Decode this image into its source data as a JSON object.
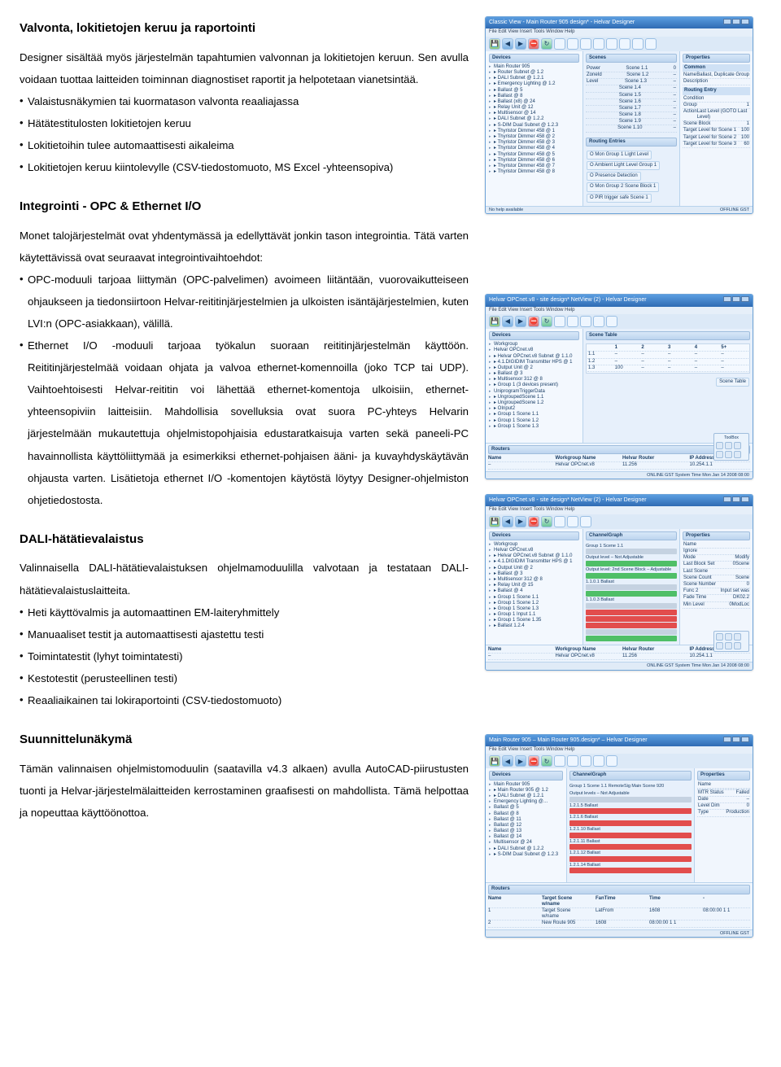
{
  "sections": {
    "valvonta": {
      "heading": "Valvonta, lokitietojen keruu ja raportointi",
      "p1": "Designer sisältää myös järjestelmän tapahtumien valvonnan ja lokitietojen keruun. Sen avulla voidaan tuottaa laitteiden toiminnan diagnostiset raportit ja helpotetaan vianetsintää.",
      "bullets": [
        "Valaistusnäkymien tai kuormatason valvonta reaaliajassa",
        "Hätätestitulosten lokitietojen keruu",
        "Lokitietoihin tulee automaattisesti aikaleima",
        "Lokitietojen keruu kiintolevylle (CSV-tiedostomuoto, MS Excel -yhteensopiva)"
      ]
    },
    "integrointi": {
      "heading": "Integrointi - OPC & Ethernet I/O",
      "p1": "Monet talojärjestelmät ovat yhdentymässä ja edellyttävät jonkin tason integrointia. Tätä varten käytettävissä ovat seuraavat integrointivaihtoehdot:",
      "bullets": [
        "OPC-moduuli tarjoaa liittymän (OPC-palvelimen) avoimeen liitäntään, vuorovaikutteiseen ohjaukseen ja tiedonsiirtoon Helvar-reititinjärjestelmien ja ulkoisten isäntäjärjestelmien, kuten LVI:n (OPC-asiakkaan), välillä.",
        "Ethernet I/O -moduuli tarjoaa työkalun suoraan reititinjärjestelmän käyttöön. Reititinjärjestelmää voidaan ohjata ja valvoa ethernet-komennoilla (joko TCP tai UDP). Vaihtoehtoisesti Helvar-reititin voi lähettää ethernet-komentoja ulkoisiin, ethernet-yhteensopiviin laitteisiin. Mahdollisia sovelluksia ovat suora PC-yhteys Helvarin järjestelmään mukautettuja ohjelmistopohjaisia edustaratkaisuja varten sekä paneeli-PC havainnollista käyttöliittymää ja esimerkiksi ethernet-pohjaisen ääni- ja kuvayhdyskäytävän ohjausta varten. Lisätietoja ethernet I/O -komentojen käytöstä löytyy Designer-ohjelmiston ohjetiedostosta."
      ]
    },
    "dali": {
      "heading": "DALI-hätätievalaistus",
      "p1": "Valinnaisella DALI-hätätievalaistuksen ohjelmamoduulilla valvotaan ja testataan DALI-hätätievalaistuslaitteita.",
      "bullets": [
        "Heti käyttövalmis ja automaattinen EM-laiteryhmittely",
        "Manuaaliset testit ja automaattisesti ajastettu testi",
        "Toimintatestit (lyhyt toimintatesti)",
        "Kestotestit (perusteellinen testi)",
        "Reaaliaikainen tai lokiraportointi (CSV-tiedostomuoto)"
      ]
    },
    "suunnittelu": {
      "heading": "Suunnittelunäkymä",
      "p1": "Tämän valinnaisen ohjelmistomoduulin (saatavilla v4.3 alkaen) avulla AutoCAD-piirustusten tuonti ja Helvar-järjestelmälaitteiden kerrostaminen graafisesti on mahdollista. Tämä helpottaa ja nopeuttaa käyttöönottoa."
    }
  },
  "screenshots": {
    "one": {
      "title": "Classic View - Main Router 905 design* - Helvar Designer",
      "menu": "File  Edit  View  Insert  Tools  Window  Help",
      "panel_devices": "Devices",
      "panel_props": "Properties",
      "panel_routing": "Routing Entries",
      "tree": [
        "Main Router 905",
        "▸ Router Subnet @ 1.2",
        "  ▸ DALI Subnet @ 1.2.1",
        "    ▸ Emergency Lighting @ 1.2",
        "    ▸ Ballast @ 5",
        "    ▸ Ballast @ 8",
        "    ▸ Ballast (x8) @ 24",
        "    ▸ Relay Unit @ 12",
        "    ▸ Multisensor @ 14",
        "  ▸ DALI Subnet @ 1.2.2",
        "  ▸ S-DIM Dual Subnet @ 1.2.3",
        "    ▸ Thyristor Dimmer 458 @ 1",
        "    ▸ Thyristor Dimmer 458 @ 2",
        "    ▸ Thyristor Dimmer 458 @ 3",
        "    ▸ Thyristor Dimmer 458 @ 4",
        "    ▸ Thyristor Dimmer 458 @ 5",
        "    ▸ Thyristor Dimmer 458 @ 6",
        "    ▸ Thyristor Dimmer 458 @ 7",
        "    ▸ Thyristor Dimmer 458 @ 8"
      ],
      "scenes_panel": "Scenes",
      "scenes_rows": [
        [
          "Power",
          "Scene 1.1",
          "0"
        ],
        [
          "ZoneId",
          "Scene 1.2",
          "–"
        ],
        [
          "Level",
          "Scene 1.3",
          "–"
        ],
        [
          "",
          "Scene 1.4",
          "–"
        ],
        [
          "",
          "Scene 1.5",
          "–"
        ],
        [
          "",
          "Scene 1.6",
          "–"
        ],
        [
          "",
          "Scene 1.7",
          "–"
        ],
        [
          "",
          "Scene 1.8",
          "–"
        ],
        [
          "",
          "Scene 1.9",
          "–"
        ],
        [
          "",
          "Scene 1.10",
          "–"
        ]
      ],
      "props_common_hdr": "Common",
      "props_common": [
        [
          "Name",
          "Ballast, Duplicate Group"
        ],
        [
          "Description",
          ""
        ]
      ],
      "routing_hdr": "Routing Entry",
      "routing_rows": [
        [
          "Condition",
          ""
        ],
        [
          "Group",
          "1"
        ],
        [
          "Action",
          "Last Level (GOTO Last Level)"
        ],
        [
          "Scene Block",
          "1"
        ],
        [
          "Target Level for Scene 1",
          "100"
        ],
        [
          "Target Level for Scene 2",
          "100"
        ],
        [
          "Target Level for Scene 3",
          "60"
        ]
      ],
      "pills": [
        [
          "O Mon Group 1 Light Level",
          "O Ambient Light Level Group 1"
        ],
        [
          "O Presence Detection",
          "O Mon Group 2 Scene Block 1"
        ],
        [
          "O PIR trigger safe Scene 1",
          ""
        ]
      ],
      "status_left": "No help available",
      "status_right": "OFFLINE   GST"
    },
    "two": {
      "title": "Helvar OPCnet.v8 - site design* NetView (2) - Helvar Designer",
      "menu": "File  Edit  View  Insert  Tools  Window  Help",
      "panel_devices": "Devices",
      "panel_table": "Scene Table",
      "tree": [
        "Workgroup",
        "Helvar OPCnet.v8",
        "▸ Helvar OPCnet.v8 Subnet @ 1.1.0",
        "  ▸ 4.1.DIGIDIM Transmitter HPS @ 1",
        "  ▸ Output Unit @ 2",
        "  ▸ Ballast @ 3",
        "  ▸ Multisensor 312 @ 8",
        "   ▸ Group 1 (3 devices present)",
        "    UniprogramTriggerData",
        "    ▸ UngroupedScene 1.1",
        "    ▸ UngroupedScene 1.2",
        "    ▸ OInput2",
        "    ▸ Group 1 Scene 1.1",
        "    ▸ Group 1 Scene 1.2",
        "    ▸ Group 1 Scene 1.3"
      ],
      "scene_cols": [
        "",
        "1",
        "2",
        "3",
        "4",
        "5+"
      ],
      "scene_rows": [
        [
          "1.1",
          "–",
          "–",
          "–",
          "–",
          "–"
        ],
        [
          "1.2",
          "–",
          "–",
          "–",
          "–",
          "–"
        ],
        [
          "1.3",
          "100",
          "–",
          "–",
          "–",
          "–"
        ]
      ],
      "btn_scene": "Scene Table",
      "routers_hdr": "Routers",
      "routers_cols": [
        "Name",
        "Workgroup Name",
        "Helvar Router",
        "IP Address"
      ],
      "routers_row": [
        "–",
        "Helvar OPCnet.v8",
        "11.256",
        "10.254.1.1"
      ],
      "palette_hdr": "ToolBox",
      "status": "ONLINE   GST   System Time  Mon Jan 14 2008 08:00"
    },
    "three": {
      "title": "Helvar OPCnet.v8 - site design* NetView (2) - Helvar Designer",
      "menu": "File  Edit  View  Insert  Tools  Window  Help",
      "panel_devices": "Devices",
      "panel_channel": "ChannelGraph",
      "panel_props": "Properties",
      "tree": [
        "Workgroup",
        "Helvar OPCnet.v8",
        "▸ Helvar OPCnet.v8 Subnet @ 1.1.0",
        "  ▸ 4.1.DIGIDIM Transmitter HPS @ 1",
        "  ▸ Output Unit @ 2",
        "  ▸ Ballast @ 3",
        "  ▸ Multisensor 312 @ 8",
        "   ▸ Relay Unit @ 15",
        "   ▸ Ballast @ 4",
        "   ▸ Group 1 Scene 1.1",
        "   ▸ Group 1 Scene 1.2",
        "   ▸ Group 1 Scene 1.3",
        "   ▸ Group 1 Input 1.1",
        "   ▸ Group 1 Scene 1.35",
        "   ▸ Ballast 1.2.4"
      ],
      "channel_rows": [
        {
          "label": "Group 1 Scene 1.1",
          "color": "grey"
        },
        {
          "label": "Output level – Not Adjustable",
          "color": "green"
        },
        {
          "label": "Output level: 2nd Scene Block – Adjustable",
          "color": "green"
        },
        {
          "label": "1.1.0.1 Ballast",
          "color": "grey"
        },
        {
          "label": "",
          "color": "green"
        },
        {
          "label": "1.1.0.3 Ballast",
          "color": "grey"
        },
        {
          "label": "",
          "color": "red"
        },
        {
          "label": "",
          "color": "red"
        },
        {
          "label": "",
          "color": "red"
        },
        {
          "label": "",
          "color": "grey"
        },
        {
          "label": "",
          "color": "green"
        }
      ],
      "props": [
        [
          "Name",
          ""
        ],
        [
          "Ignore",
          ""
        ],
        [
          "Mode",
          "Modify"
        ],
        [
          "Last Block Set",
          "0Scene"
        ],
        [
          "Last Scene",
          ""
        ],
        [
          "Scene Count",
          "Scene"
        ],
        [
          "Scene Number",
          "0"
        ],
        [
          "Func 2",
          "Input set was"
        ],
        [
          "Fade Time",
          "DK02.2"
        ],
        [
          "Min Level",
          "0ModLoc"
        ]
      ],
      "routers_cols": [
        "Name",
        "Workgroup Name",
        "Helvar Router",
        "IP Address"
      ],
      "routers_row": [
        "–",
        "Helvar OPCnet.v8",
        "11.256",
        "10.254.1.1"
      ],
      "status": "ONLINE   GST   System Time  Mon Jan 14 2008 08:00"
    },
    "four": {
      "title": "Main Router 905 – Main Router 905.design* – Helvar Designer",
      "menu": "File  Edit  View  Insert  Tools  Window  Help",
      "panel_devices": "Devices",
      "panel_channel": "ChannelGraph",
      "panel_props": "Properties",
      "tree": [
        "Main Router 905",
        "▸ Main Router 905 @ 1.2",
        "  ▸ DALI Subnet @ 1.2.1",
        "    Emergency Lighting @…",
        "    Ballast @ 5",
        "    Ballast @ 8",
        "    Ballast @ 11",
        "    Ballast @ 12",
        "    Ballast @ 13",
        "    Ballast @ 14",
        "    Multisensor @ 24",
        "  ▸ DALI Subnet @ 1.2.2",
        "▸ S-DIM Dual Subnet @ 1.2.3"
      ],
      "channel_title": "Group 1 Scene 1.1 RemoteSig Main Scene 920",
      "channel_rows": [
        {
          "label": "Output levels – Not Adjustable",
          "color": "grey"
        },
        {
          "label": "1.2.1.5 Ballast",
          "color": "red"
        },
        {
          "label": "1.2.1.6 Ballast",
          "color": "red"
        },
        {
          "label": "1.2.1.10 Ballast",
          "color": "red"
        },
        {
          "label": "1.2.1.11 Ballast",
          "color": "red"
        },
        {
          "label": "1.2.1.12 Ballast",
          "color": "red"
        },
        {
          "label": "1.2.1.14 Ballast",
          "color": "red"
        }
      ],
      "props": [
        [
          "Name",
          ""
        ],
        [
          "",
          ""
        ],
        [
          "",
          ""
        ],
        [
          "MTR Status",
          "Failed"
        ],
        [
          "    Date",
          "–"
        ],
        [
          "    Level Dim",
          "0"
        ],
        [
          "    Type",
          "Production"
        ]
      ],
      "routers_hdr": "Routers",
      "bottom_cols": [
        "Name",
        "Target Scene w/name",
        "FanTime",
        "Time",
        "-"
      ],
      "bottom_rows": [
        [
          "1",
          "Target Scene w/name",
          "LatFrom",
          "1608",
          "08:00:00 1 1"
        ],
        [
          "2",
          "New Route 905",
          "1608",
          "08:00:00 1 1",
          ""
        ]
      ],
      "status": "OFFLINE   GST"
    }
  }
}
